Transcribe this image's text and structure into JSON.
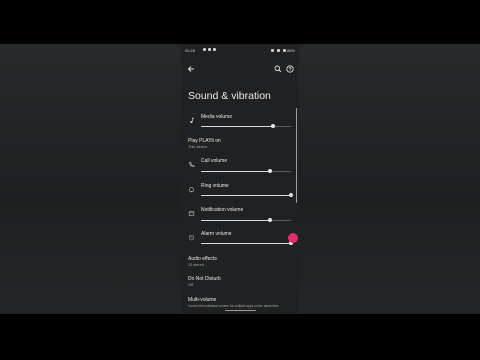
{
  "status_bar": {
    "time": "00:26",
    "battery": "86%"
  },
  "header": {
    "title": "Sound & vibration"
  },
  "settings": {
    "media_volume": {
      "label": "Media volume",
      "level": 0.8
    },
    "play_on": {
      "label": "Play PLAYit on",
      "value": "This device"
    },
    "call_volume": {
      "label": "Call volume",
      "level": 0.77
    },
    "ring_volume": {
      "label": "Ring volume",
      "level": 1.0
    },
    "notification_volume": {
      "label": "Notification volume",
      "level": 0.77
    },
    "alarm_volume": {
      "label": "Alarm volume",
      "level": 1.0
    },
    "audio_effects": {
      "label": "Audio effects",
      "value": "10 stereo"
    },
    "do_not_disturb": {
      "label": "Do Not Disturb",
      "value": "Off"
    },
    "multi_volume": {
      "label": "Multi-volume",
      "value": "Control the individual volume for multiple apps on the same time"
    }
  },
  "colors": {
    "accent": "#e52d6e",
    "background": "#202122",
    "text": "#e8e8e8"
  },
  "icons": [
    "back-arrow-icon",
    "search-icon",
    "help-icon",
    "music-note-icon",
    "phone-icon",
    "bell-icon",
    "notification-icon",
    "alarm-icon"
  ]
}
